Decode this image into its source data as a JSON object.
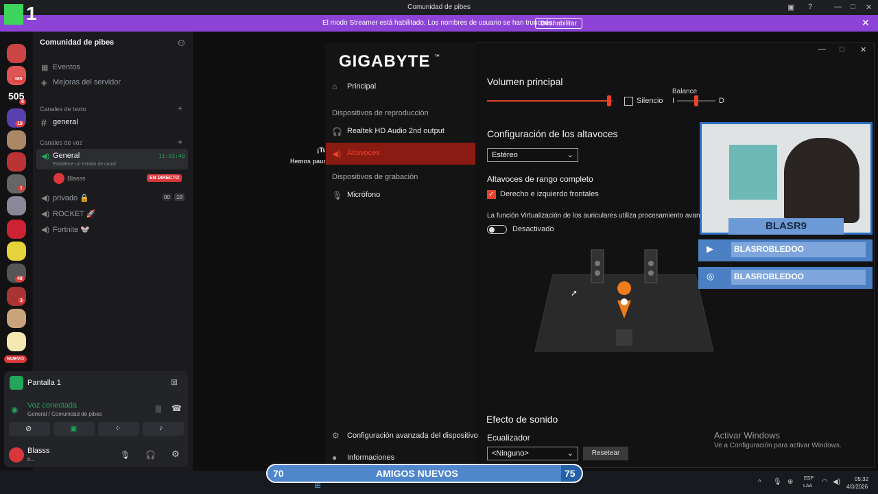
{
  "window": {
    "title": "Comunidad de pibes"
  },
  "banner": {
    "text": "El modo Streamer está habilitado. Los nombres de usuario se han truncado.",
    "button": "Deshabilitar"
  },
  "rail": {
    "logo_text": "1",
    "badges": [
      "389",
      "8",
      "19",
      "1",
      "48",
      "3"
    ],
    "new_label": "NUEVO",
    "server_505": "505"
  },
  "sidebar": {
    "server_name": "Comunidad de pibes",
    "events": "Eventos",
    "boosts": "Mejoras del servidor",
    "text_category": "Canales de texto",
    "text_channel": "general",
    "voice_category": "Canales de voz",
    "voice_general": "General",
    "voice_time": "11:03:40",
    "voice_status_hint": "Establece un estado de canal",
    "voice_user": "Blasss",
    "live_badge": "EN DIRECTO",
    "voice_privado": "privado 🔒",
    "privado_count_a": "00",
    "privado_count_b": "10",
    "voice_rocket": "ROCKET 🚀",
    "voice_fortnite": "Fortnite 🐭",
    "screen_share": "Pantalla 1",
    "voice_connected": "Voz conectada",
    "voice_location": "General / Comunidad de pibes",
    "user_name": "Blasss",
    "user_sub": "b..."
  },
  "main": {
    "partial_text_1": "¡Tu",
    "partial_text_2": "Hemos pausa"
  },
  "gigabyte": {
    "brand": "GIGABYTE",
    "tm": "™",
    "nav": {
      "principal": "Principal",
      "playback_header": "Dispositivos de reproducción",
      "playback_device": "Realtek HD Audio 2nd output",
      "speakers": "Altavoces",
      "recording_header": "Dispositivos de grabación",
      "microphone": "Micrófono",
      "advanced": "Configuración avanzada del dispositivo",
      "info": "Informaciones"
    },
    "main_volume": "Volumen principal",
    "main_volume_level": 0.97,
    "mute_label": "Silencio",
    "balance_label": "Balance",
    "balance_left": "I",
    "balance_right": "D",
    "balance_level": 0.5,
    "speaker_config": "Configuración de los altavoces",
    "speaker_select": "Estéreo",
    "fullrange": "Altavoces de rango completo",
    "fullrange_check": "Derecho e izquierdo frontales",
    "virt_text": "La función Virtualización de los auriculares utiliza procesamiento avanz",
    "virt_toggle": "Desactivado",
    "sound_effect": "Efecto de sonido",
    "equalizer": "Ecualizador",
    "eq_select": "<Ninguno>",
    "reset": "Resetear"
  },
  "overlay": {
    "cam_name": "BLASR9",
    "youtube": "BLASROBLEDOO",
    "instagram": "BLASROBLEDOO",
    "amigos_left": "70",
    "amigos_label": "AMIGOS NUEVOS",
    "amigos_right": "75"
  },
  "activate": {
    "title": "Activar Windows",
    "sub": "Ve a Configuración para activar Windows."
  },
  "taskbar": {
    "lang1": "ESP",
    "lang2": "LAA",
    "time": "05:32",
    "date": "4/3/2026"
  },
  "colors": {
    "streamer_banner": "#8d44d6",
    "gigabyte_accent": "#e8412b",
    "discord_green": "#23a55a",
    "live_red": "#da373c"
  }
}
